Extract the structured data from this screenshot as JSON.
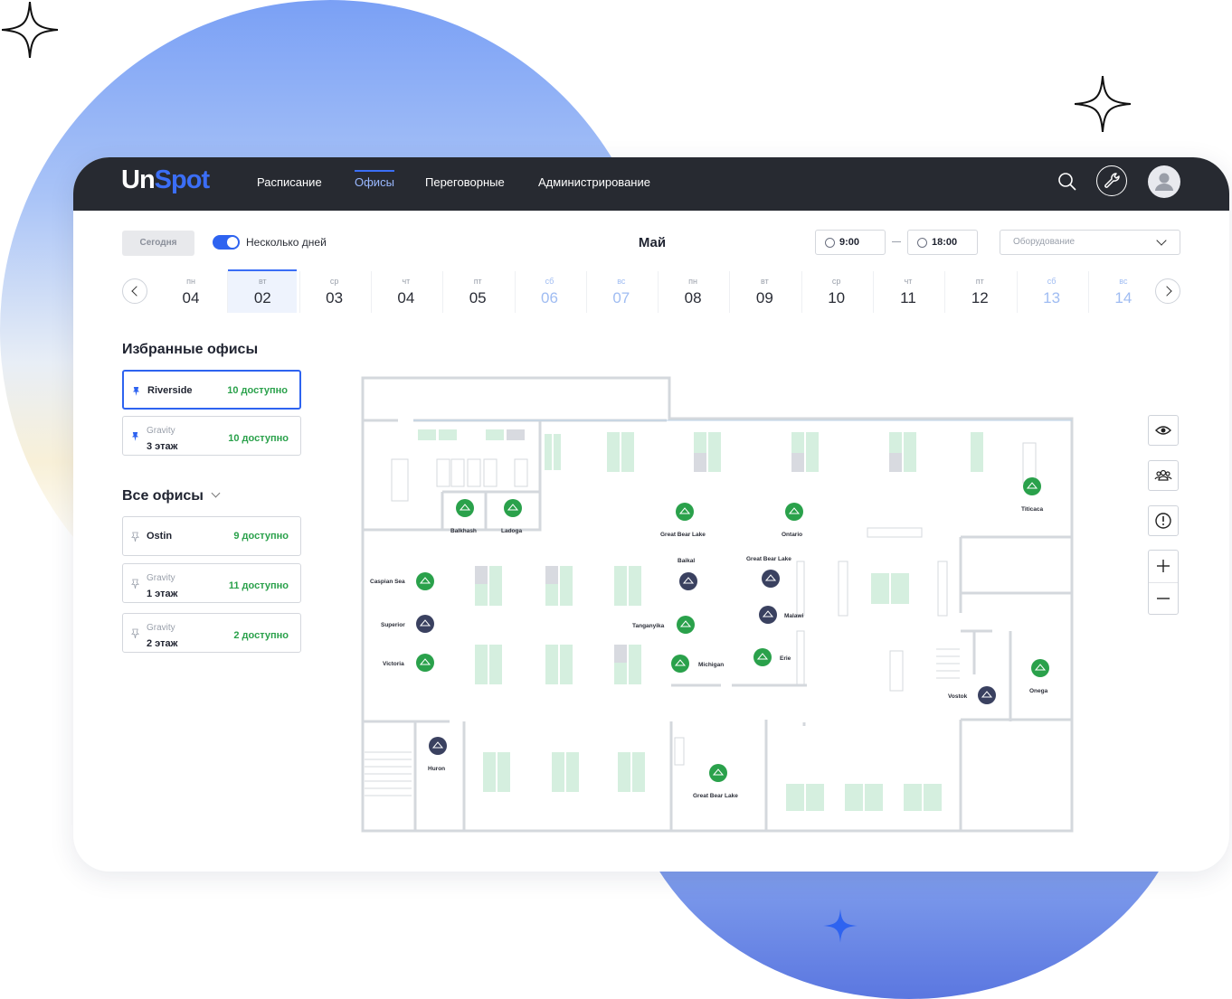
{
  "app": {
    "logo_part1": "Un",
    "logo_part2": "Spot"
  },
  "nav": [
    "Расписание",
    "Офисы",
    "Переговорные",
    "Администрирование"
  ],
  "nav_active": "Офисы",
  "toolbar": {
    "today_label": "Сегодня",
    "multi_day_label": "Несколько дней",
    "multi_day_enabled": true,
    "month": "Май",
    "time_from": "9:00",
    "time_to": "18:00",
    "equipment_placeholder": "Оборудование"
  },
  "days": [
    {
      "dow": "пн",
      "num": "04",
      "weekend": false,
      "selected": false
    },
    {
      "dow": "вт",
      "num": "02",
      "weekend": false,
      "selected": true
    },
    {
      "dow": "ср",
      "num": "03",
      "weekend": false,
      "selected": false
    },
    {
      "dow": "чт",
      "num": "04",
      "weekend": false,
      "selected": false
    },
    {
      "dow": "пт",
      "num": "05",
      "weekend": false,
      "selected": false
    },
    {
      "dow": "сб",
      "num": "06",
      "weekend": true,
      "selected": false
    },
    {
      "dow": "вс",
      "num": "07",
      "weekend": true,
      "selected": false
    },
    {
      "dow": "пн",
      "num": "08",
      "weekend": false,
      "selected": false
    },
    {
      "dow": "вт",
      "num": "09",
      "weekend": false,
      "selected": false
    },
    {
      "dow": "ср",
      "num": "10",
      "weekend": false,
      "selected": false
    },
    {
      "dow": "чт",
      "num": "11",
      "weekend": false,
      "selected": false
    },
    {
      "dow": "пт",
      "num": "12",
      "weekend": false,
      "selected": false
    },
    {
      "dow": "сб",
      "num": "13",
      "weekend": true,
      "selected": false
    },
    {
      "dow": "вс",
      "num": "14",
      "weekend": true,
      "selected": false
    }
  ],
  "favorites": {
    "title": "Избранные офисы",
    "items": [
      {
        "name": "Riverside",
        "sub": "",
        "avail": "10 доступно"
      },
      {
        "name": "3 этаж",
        "sub": "Gravity",
        "avail": "10 доступно"
      }
    ]
  },
  "all_offices": {
    "title": "Все офисы",
    "items": [
      {
        "name": "Ostin",
        "sub": "",
        "avail": "9 доступно"
      },
      {
        "name": "1 этаж",
        "sub": "Gravity",
        "avail": "11 доступно"
      },
      {
        "name": "2 этаж",
        "sub": "Gravity",
        "avail": "2 доступно"
      }
    ]
  },
  "rooms": {
    "balkhash": "Balkhash",
    "ladoga": "Ladoga",
    "great_bear_lake_1": "Great Bear Lake",
    "ontario": "Ontario",
    "titicaca": "Titicaca",
    "baikal": "Baikal",
    "great_bear_lake_2": "Great Bear Lake",
    "caspian_sea": "Caspian Sea",
    "superior": "Superior",
    "victoria": "Victoria",
    "tanganyika": "Tanganyika",
    "malawi": "Malawi",
    "michigan": "Michigan",
    "erie": "Erie",
    "vostok": "Vostok",
    "onega": "Onega",
    "huron": "Huron",
    "great_bear_lake_3": "Great Bear Lake"
  },
  "colors": {
    "accent": "#2e63f0",
    "available": "#2aa14b",
    "booked": "#3a4160",
    "desk_free": "#d5efdf",
    "desk_busy": "#d8dae0"
  }
}
